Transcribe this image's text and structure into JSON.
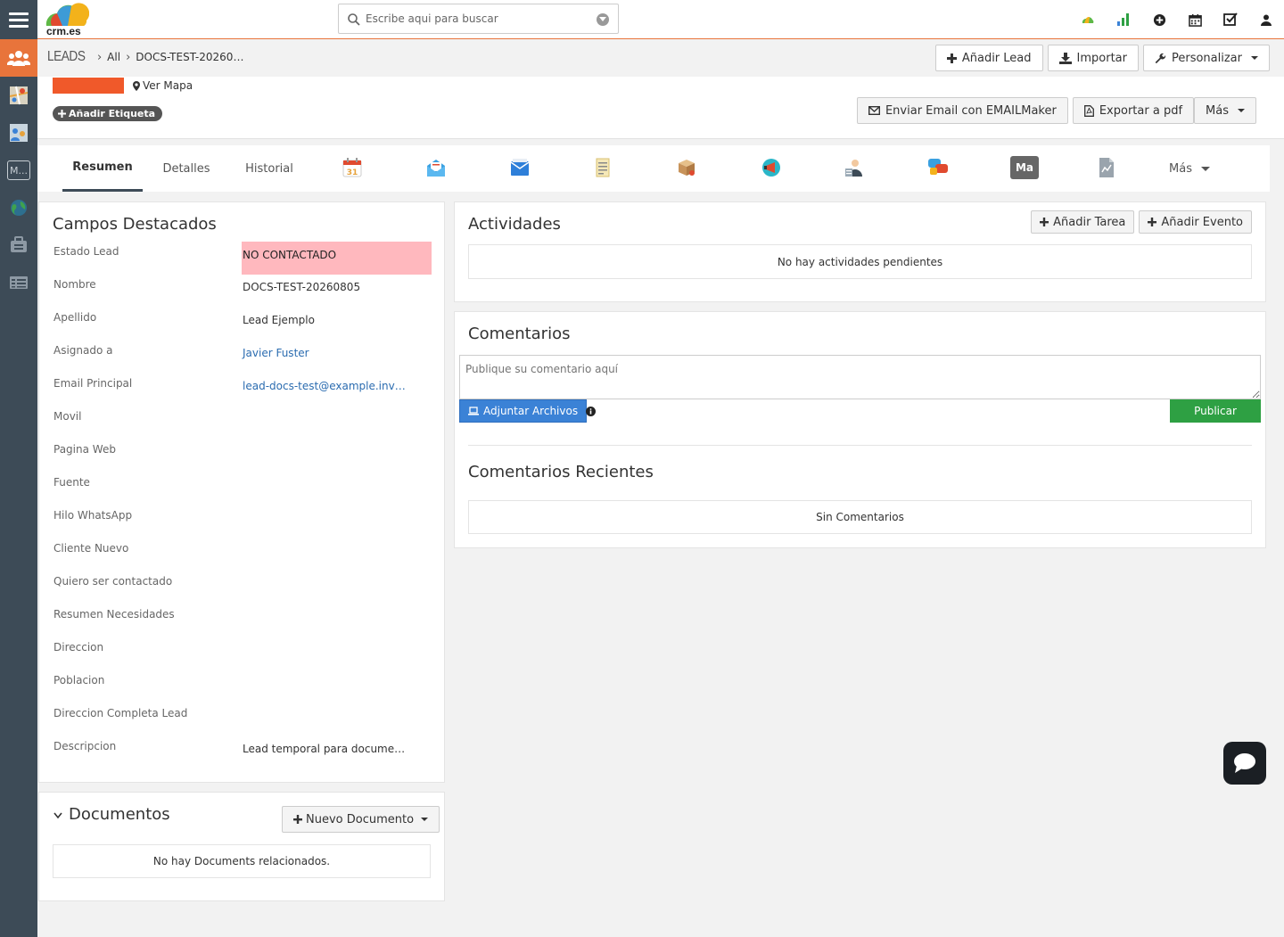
{
  "brand": {
    "logo_text": "crm.es"
  },
  "search": {
    "placeholder": "Escribe aqui para buscar"
  },
  "breadcrumb": {
    "module": "LEADS",
    "filter": "All",
    "record": "DOCS-TEST-20260…"
  },
  "header_actions": {
    "add_lead": "Añadir Lead",
    "import": "Importar",
    "customize": "Personalizar"
  },
  "record": {
    "ver_mapa": "Ver Mapa",
    "add_tag": "Añadir Etiqueta",
    "send_email": "Enviar Email con EMAILMaker",
    "export_pdf": "Exportar a pdf",
    "more": "Más"
  },
  "tabs": {
    "summary": "Resumen",
    "details": "Detalles",
    "history": "Historial",
    "calendar_day": "31",
    "ma_badge": "Ma",
    "more": "Más"
  },
  "key_fields": {
    "title": "Campos Destacados",
    "rows": [
      {
        "label": "Estado Lead",
        "value": "NO CONTACTADO"
      },
      {
        "label": "Nombre",
        "value": "DOCS-TEST-20260805"
      },
      {
        "label": "Apellido",
        "value": "Lead Ejemplo"
      },
      {
        "label": "Asignado a",
        "value": "Javier Fuster"
      },
      {
        "label": "Email Principal",
        "value": "lead-docs-test@example.inv…"
      },
      {
        "label": "Movil",
        "value": ""
      },
      {
        "label": "Pagina Web",
        "value": ""
      },
      {
        "label": "Fuente",
        "value": ""
      },
      {
        "label": "Hilo WhatsApp",
        "value": ""
      },
      {
        "label": "Cliente Nuevo",
        "value": ""
      },
      {
        "label": "Quiero ser contactado",
        "value": ""
      },
      {
        "label": "Resumen Necesidades",
        "value": ""
      },
      {
        "label": "Direccion",
        "value": ""
      },
      {
        "label": "Poblacion",
        "value": ""
      },
      {
        "label": "Direccion Completa Lead",
        "value": ""
      },
      {
        "label": "Descripcion",
        "value": "Lead temporal para docume…"
      }
    ],
    "status_color": "#ffb8be"
  },
  "documents": {
    "title": "Documentos",
    "new_doc": "Nuevo Documento",
    "empty": "No hay Documents relacionados."
  },
  "activities": {
    "title": "Actividades",
    "add_task": "Añadir Tarea",
    "add_event": "Añadir Evento",
    "empty": "No hay actividades pendientes"
  },
  "comments": {
    "title": "Comentarios",
    "placeholder": "Publique su comentario aquí",
    "attach": "Adjuntar Archivos",
    "publish": "Publicar",
    "recent_title": "Comentarios Recientes",
    "recent_empty": "Sin Comentarios"
  },
  "colors": {
    "accent": "#e8743b",
    "sidebar": "#3d4b57",
    "publish": "#2ea043",
    "attach": "#3b82d6"
  }
}
